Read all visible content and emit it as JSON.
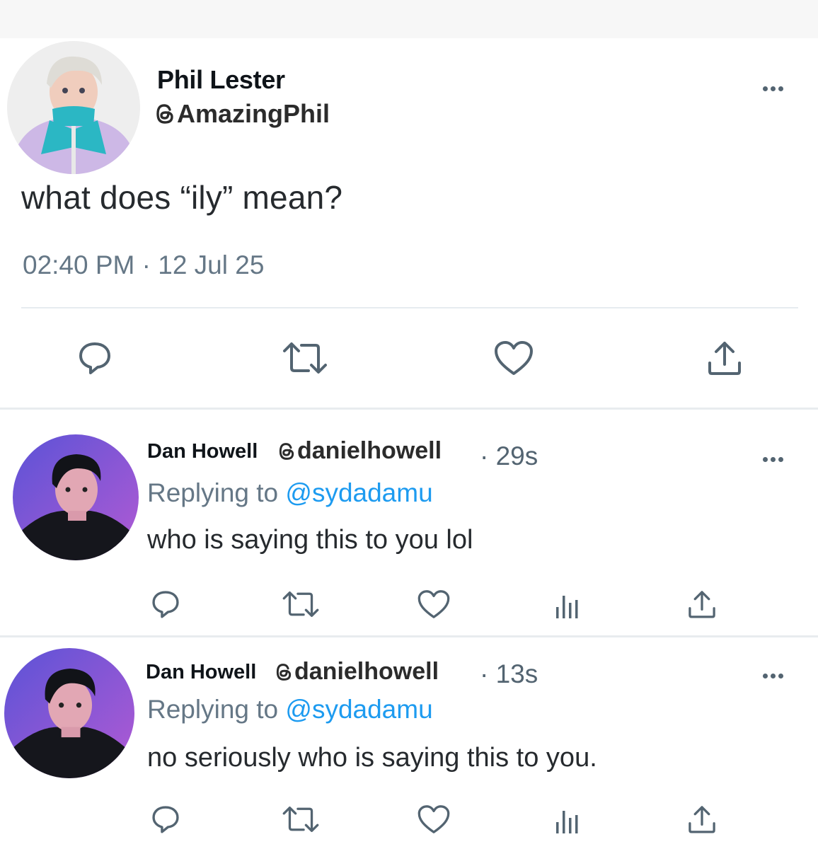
{
  "main_tweet": {
    "author_name": "Phil Lester",
    "author_handle": "AmazingPhil",
    "avatar_icon": "profile-photo-blond-man-teal-jacket",
    "text": "what does “ily” mean?",
    "timestamp": "02:40 PM · 12 Jul 25",
    "actions": [
      "reply-icon",
      "retweet-icon",
      "like-icon",
      "share-icon"
    ]
  },
  "replies": [
    {
      "author_name": "Dan Howell",
      "author_handle": "danielhowell",
      "age": "· 29s",
      "replying_prefix": "Replying to ",
      "replying_to": "@sydadamu",
      "text": "who is saying this to you lol",
      "actions": [
        "reply-icon",
        "retweet-icon",
        "like-icon",
        "views-icon",
        "share-icon"
      ]
    },
    {
      "author_name": "Dan Howell",
      "author_handle": "danielhowell",
      "age": "· 13s",
      "replying_prefix": "Replying to ",
      "replying_to": "@sydadamu",
      "text": "no seriously who is saying this to you.",
      "actions": [
        "reply-icon",
        "retweet-icon",
        "like-icon",
        "views-icon",
        "share-icon"
      ]
    }
  ],
  "colors": {
    "link": "#1d9bf0",
    "icon": "#536471",
    "secondary_text": "#657786"
  }
}
